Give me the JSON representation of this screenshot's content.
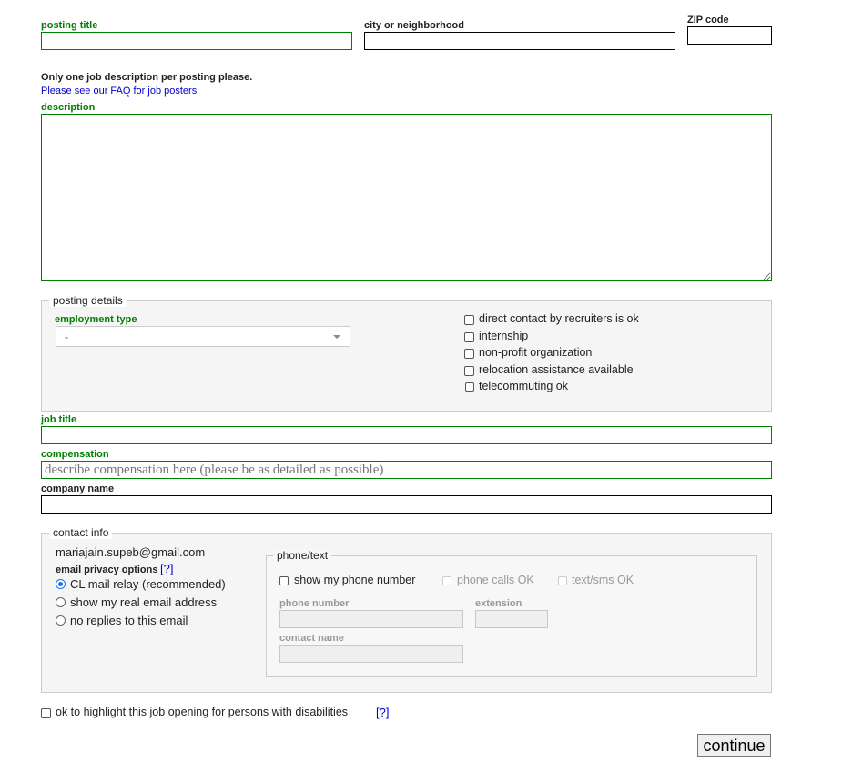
{
  "fields": {
    "posting_title": {
      "label": "posting title",
      "value": ""
    },
    "city": {
      "label": "city or neighborhood",
      "value": ""
    },
    "zip": {
      "label": "ZIP code",
      "value": ""
    },
    "description": {
      "label": "description",
      "value": ""
    },
    "job_title": {
      "label": "job title",
      "value": ""
    },
    "compensation": {
      "label": "compensation",
      "value": "",
      "placeholder": "describe compensation here (please be as detailed as possible)"
    },
    "company_name": {
      "label": "company name",
      "value": ""
    }
  },
  "notice": {
    "text": "Only one job description per posting please.",
    "faq_link": "Please see our FAQ for job posters"
  },
  "posting_details": {
    "legend": "posting details",
    "employment_type": {
      "label": "employment type",
      "selected": "-"
    },
    "options": [
      {
        "label": "direct contact by recruiters is ok",
        "checked": false
      },
      {
        "label": "internship",
        "checked": false
      },
      {
        "label": "non-profit organization",
        "checked": false
      },
      {
        "label": "relocation assistance available",
        "checked": false
      },
      {
        "label": "telecommuting ok",
        "checked": false
      }
    ]
  },
  "contact_info": {
    "legend": "contact info",
    "email": "mariajain.supeb@gmail.com",
    "privacy_label": "email privacy options",
    "help_link": "[?]",
    "privacy_options": [
      {
        "label": "CL mail relay (recommended)",
        "selected": true
      },
      {
        "label": "show my real email address",
        "selected": false
      },
      {
        "label": "no replies to this email",
        "selected": false
      }
    ],
    "phone": {
      "legend": "phone/text",
      "show_phone": "show my phone number",
      "calls_ok": "phone calls OK",
      "sms_ok": "text/sms OK",
      "phone_number_label": "phone number",
      "extension_label": "extension",
      "contact_name_label": "contact name"
    }
  },
  "disabilities": {
    "label": "ok to highlight this job opening for persons with disabilities",
    "help_link": "[?]"
  },
  "continue_button": "continue"
}
